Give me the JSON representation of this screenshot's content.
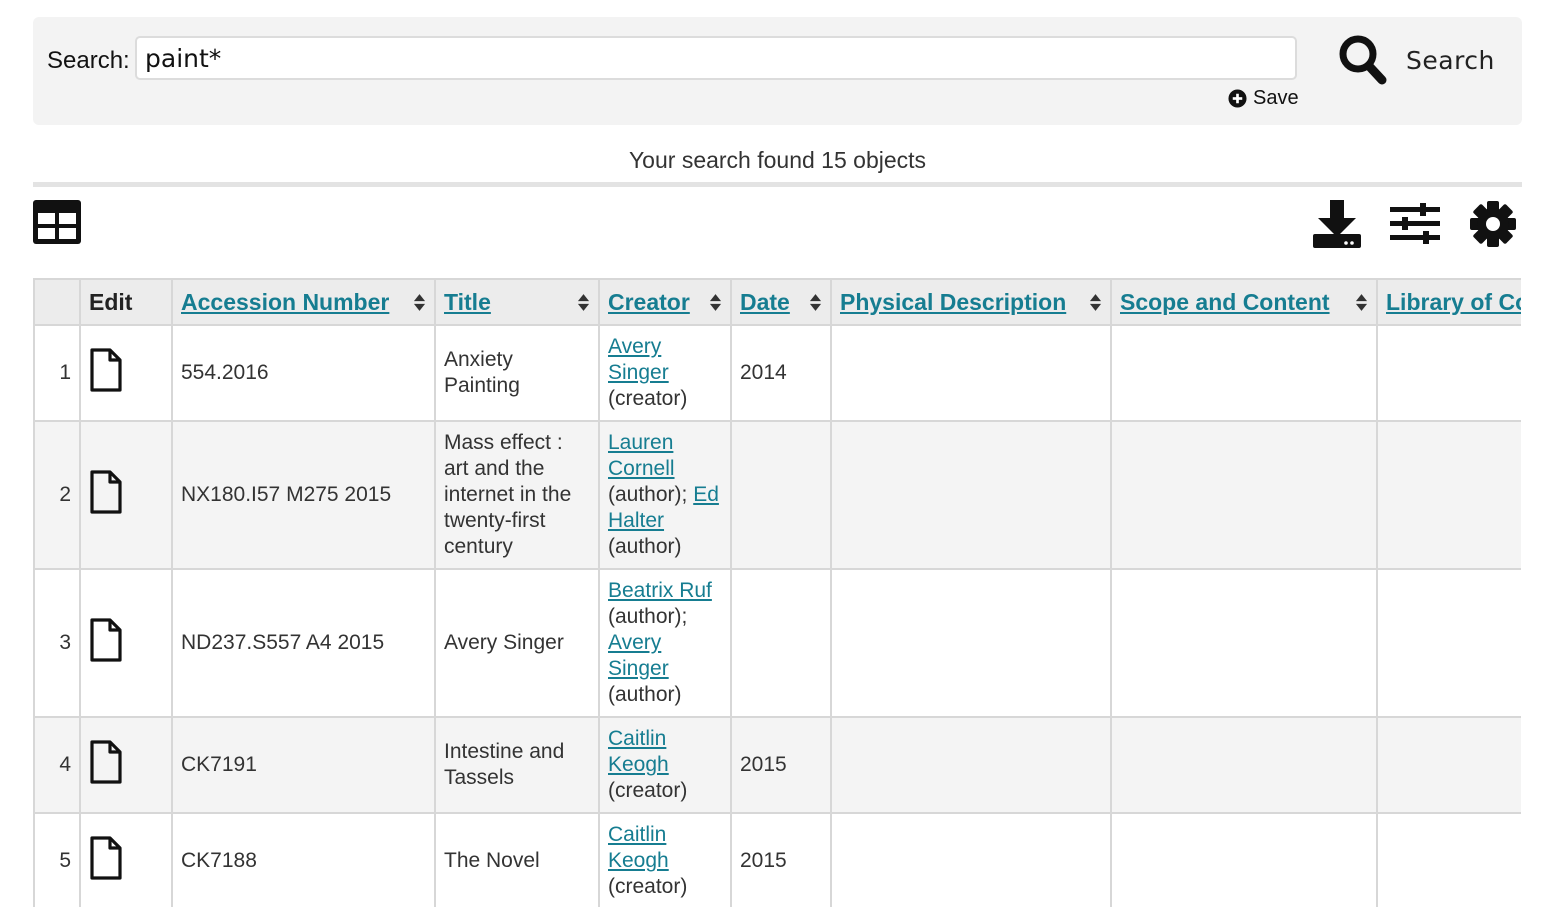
{
  "search": {
    "label": "Search:",
    "query": "paint*",
    "save_label": "Save",
    "button_label": "Search"
  },
  "results": {
    "summary": "Your search found 15 objects"
  },
  "icons": {
    "view": "table-view-icon",
    "download": "download-icon",
    "filters": "sliders-icon",
    "settings": "gear-icon",
    "edit": "document-icon",
    "sort": "sort-arrows-icon",
    "save": "plus-circle-icon",
    "search": "magnifier-icon"
  },
  "colors": {
    "link": "#167d91",
    "panel_bg": "#f3f3f3",
    "header_bg": "#ececec"
  },
  "table": {
    "columns": {
      "edit": "Edit",
      "accession": "Accession Number",
      "title": "Title",
      "creator": "Creator",
      "date": "Date",
      "physical": "Physical Description",
      "scope": "Scope and Content",
      "loc": "Library of Co"
    },
    "rows": [
      {
        "num": "1",
        "accession": "554.2016",
        "title": "Anxiety Painting",
        "creators": [
          {
            "name": "Avery Singer",
            "role": "(creator)"
          }
        ],
        "date": "2014",
        "physical": "",
        "scope": "",
        "loc": ""
      },
      {
        "num": "2",
        "accession": "NX180.I57 M275 2015",
        "title": "Mass effect : art and the internet in the twenty-first century",
        "creators": [
          {
            "name": "Lauren Cornell",
            "role": "(author);"
          },
          {
            "name": "Ed Halter",
            "role": "(author)"
          }
        ],
        "date": "",
        "physical": "",
        "scope": "",
        "loc": ""
      },
      {
        "num": "3",
        "accession": "ND237.S557 A4 2015",
        "title": "Avery Singer",
        "creators": [
          {
            "name": "Beatrix Ruf",
            "role": "(author);"
          },
          {
            "name": "Avery Singer",
            "role": "(author)"
          }
        ],
        "date": "",
        "physical": "",
        "scope": "",
        "loc": ""
      },
      {
        "num": "4",
        "accession": "CK7191",
        "title": "Intestine and Tassels",
        "creators": [
          {
            "name": "Caitlin Keogh",
            "role": "(creator)"
          }
        ],
        "date": "2015",
        "physical": "",
        "scope": "",
        "loc": ""
      },
      {
        "num": "5",
        "accession": "CK7188",
        "title": "The Novel",
        "creators": [
          {
            "name": "Caitlin Keogh",
            "role": "(creator)"
          }
        ],
        "date": "2015",
        "physical": "",
        "scope": "",
        "loc": ""
      }
    ]
  }
}
